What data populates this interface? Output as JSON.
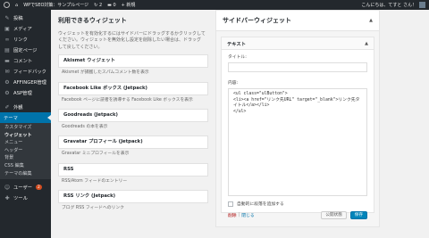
{
  "adminbar": {
    "site_name": "WPでSEO対策：サンプルページ",
    "updates_count": "2",
    "comments_count": "0",
    "new_label": "+ 新規",
    "greeting": "こんにちは、てすと さん！"
  },
  "sidebar": {
    "items": [
      {
        "label": "投稿",
        "icon": "pin-icon"
      },
      {
        "label": "メディア",
        "icon": "media-icon"
      },
      {
        "label": "リンク",
        "icon": "link-icon"
      },
      {
        "label": "固定ページ",
        "icon": "page-icon"
      },
      {
        "label": "コメント",
        "icon": "comment-icon"
      },
      {
        "label": "フィードバック",
        "icon": "feedback-icon"
      },
      {
        "label": "AFFINGER管理",
        "icon": "gear-icon"
      },
      {
        "label": "ASP管理",
        "icon": "gear-icon"
      },
      {
        "label": "外観",
        "icon": "brush-icon"
      },
      {
        "label": "テーマ",
        "icon": ""
      }
    ],
    "submenu": [
      "カスタマイズ",
      "ウィジェット",
      "メニュー",
      "ヘッダー",
      "背景",
      "CSS 編集",
      "テーマの編集"
    ],
    "bottom": [
      {
        "label": "ユーザー",
        "icon": "user-icon",
        "badge": "2"
      },
      {
        "label": "ツール",
        "icon": "tool-icon"
      }
    ]
  },
  "available": {
    "title": "利用できるウィジェット",
    "description": "ウィジェットを有効化するにはサイドバーにドラッグするかクリックしてください。ウィジェットを無効化し設定を削除したい場合は、ドラッグして戻してください。",
    "widgets": [
      {
        "name": "Akismet ウィジェット",
        "desc": "Akismet が捕獲したスパムコメント数を表示"
      },
      {
        "name": "Facebook Like ボックス (Jetpack)",
        "desc": "Facebook ページに読者を誘導する Facebook Like ボックスを表示"
      },
      {
        "name": "Goodreads (Jetpack)",
        "desc": "Goodreads の本を表示"
      },
      {
        "name": "Gravatar プロフィール (Jetpack)",
        "desc": "Gravatar ミニプロフィールを表示"
      },
      {
        "name": "RSS",
        "desc": "RSS/Atom フィードのエントリー"
      },
      {
        "name": "RSS リンク (Jetpack)",
        "desc": "ブログ RSS フィードへのリンク"
      }
    ]
  },
  "sidebar_widgets": {
    "title": "サイドバーウィジェット",
    "text_widget": {
      "header": "テキスト",
      "title_label": "タイトル:",
      "title_value": "",
      "content_label": "内容:",
      "content_value": "<ul class=\"ulButton\">\n<li><a href=\"リンク先URL\" target=\"_blank\">リンク先タイトル</a></li>\n</ul>",
      "autop_label": "自動的に段落を追加する",
      "delete_label": "削除",
      "close_label": "閉じる",
      "saved_label": "公開状態",
      "save_label": "保存"
    }
  },
  "colors": {
    "adminbar_bg": "#23282d",
    "accent": "#0073aa",
    "primary_button": "#0085ba"
  }
}
